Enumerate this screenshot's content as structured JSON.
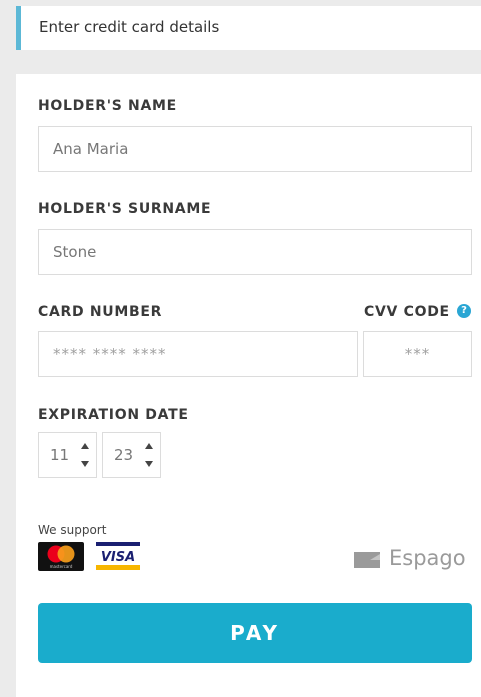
{
  "header": {
    "title": "Enter credit card details"
  },
  "form": {
    "holder_name": {
      "label": "HOLDER'S NAME",
      "value": "Ana Maria"
    },
    "holder_surname": {
      "label": "HOLDER'S SURNAME",
      "value": "Stone"
    },
    "card_number": {
      "label": "CARD NUMBER",
      "placeholder": "**** **** ****"
    },
    "cvv": {
      "label": "CVV CODE",
      "placeholder": "***",
      "help_icon": "question-icon",
      "help_glyph": "?"
    },
    "expiration": {
      "label": "EXPIRATION DATE",
      "month": "11",
      "year": "23"
    }
  },
  "support": {
    "label": "We support",
    "mastercard_caption": "mastercard",
    "visa_text": "VISA"
  },
  "espago": {
    "name": "Espago"
  },
  "pay_button": {
    "label": "PAY"
  },
  "colors": {
    "accent": "#1aaccc",
    "header_stripe": "#5cb8d6",
    "help_icon": "#2aa6d4",
    "mastercard_red": "#eb001b",
    "mastercard_orange": "#f79e1b",
    "visa_blue": "#1a1f71",
    "visa_gold": "#f7b600"
  }
}
